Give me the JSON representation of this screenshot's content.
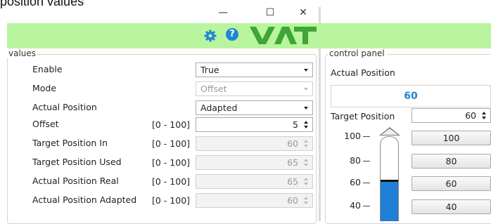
{
  "caption": "position values",
  "window": {
    "minimize_glyph": "—",
    "maximize_glyph": "☐",
    "close_glyph": "✕"
  },
  "toolbar": {
    "settings_icon": "gear-icon",
    "help_icon": "help-icon",
    "help_glyph": "?",
    "logo_text": "VAT",
    "bar_color": "#b8f59e",
    "accent_color": "#1f86d6"
  },
  "values_panel": {
    "title": "values",
    "rows": [
      {
        "label": "Enable",
        "range": "",
        "kind": "combo",
        "value": "True",
        "enabled": true
      },
      {
        "label": "Mode",
        "range": "",
        "kind": "combo",
        "value": "Offset",
        "enabled": false
      },
      {
        "label": "Actual Position",
        "range": "",
        "kind": "combo",
        "value": "Adapted",
        "enabled": true
      },
      {
        "label": "Offset",
        "range": "[0 - 100]",
        "kind": "spin",
        "value": "5",
        "enabled": true
      },
      {
        "label": "Target Position In",
        "range": "[0 - 100]",
        "kind": "spin",
        "value": "60",
        "enabled": false
      },
      {
        "label": "Target Position Used",
        "range": "[0 - 100]",
        "kind": "spin",
        "value": "65",
        "enabled": false
      },
      {
        "label": "Actual Position Real",
        "range": "[0 - 100]",
        "kind": "spin",
        "value": "65",
        "enabled": false
      },
      {
        "label": "Actual Position Adapted",
        "range": "[0 - 100]",
        "kind": "spin",
        "value": "60",
        "enabled": false
      }
    ]
  },
  "control_panel": {
    "title": "control panel",
    "actual_position_label": "Actual Position",
    "actual_position_value": "60",
    "target_position_label": "Target Position",
    "target_position_value": "60",
    "gauge_ticks": [
      "100",
      "80",
      "60",
      "40"
    ],
    "gauge_level": 0.6,
    "preset_buttons": [
      "100",
      "80",
      "60",
      "40"
    ]
  }
}
